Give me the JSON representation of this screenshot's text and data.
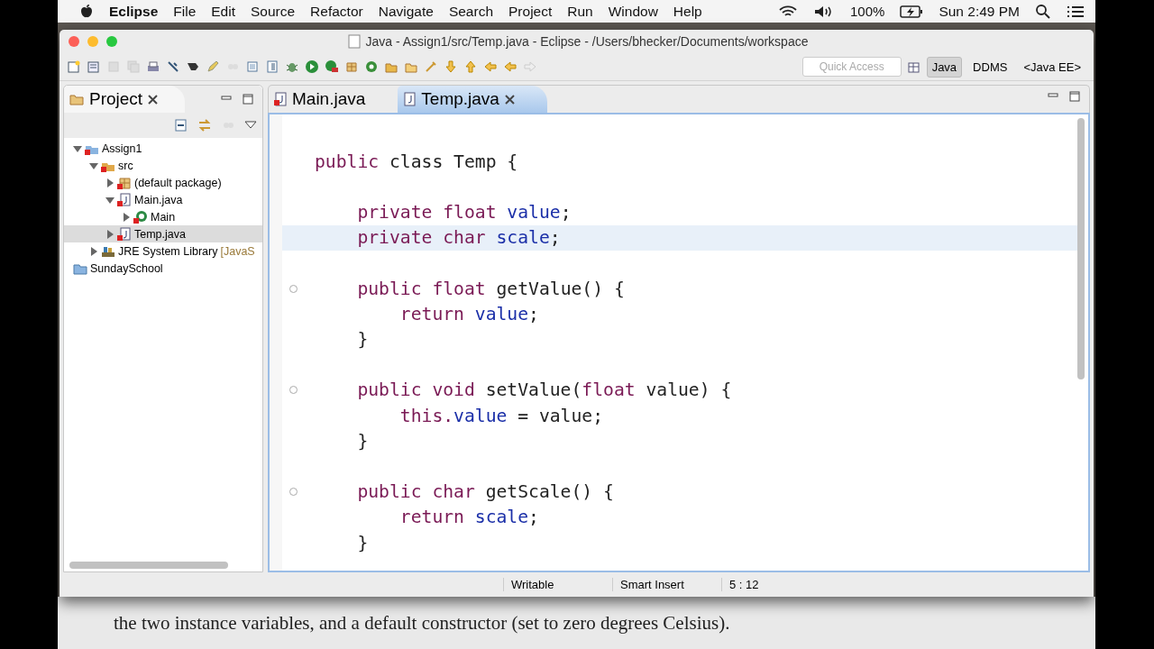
{
  "menubar": {
    "app": "Eclipse",
    "items": [
      "File",
      "Edit",
      "Source",
      "Refactor",
      "Navigate",
      "Search",
      "Project",
      "Run",
      "Window",
      "Help"
    ],
    "battery": "100%",
    "clock": "Sun 2:49 PM"
  },
  "window": {
    "title": "Java - Assign1/src/Temp.java - Eclipse - /Users/bhecker/Documents/workspace"
  },
  "toolbar": {
    "quick_access": {
      "placeholder": "Quick Access"
    },
    "perspectives": [
      {
        "label": "Java",
        "selected": true
      },
      {
        "label": "DDMS",
        "selected": false
      },
      {
        "label": "<Java EE>",
        "selected": false
      }
    ]
  },
  "project_view": {
    "title": "Project",
    "tree": [
      {
        "label": "Assign1",
        "kind": "project",
        "expanded": true,
        "selected": false,
        "children": [
          {
            "label": "src",
            "kind": "folder",
            "expanded": true,
            "selected": false,
            "children": [
              {
                "label": "(default package)",
                "kind": "package",
                "expanded": false,
                "selected": false
              },
              {
                "label": "Main.java",
                "kind": "file",
                "expanded": true,
                "selected": false,
                "children": [
                  {
                    "label": "Main",
                    "kind": "class",
                    "expanded": false,
                    "selected": false
                  }
                ]
              },
              {
                "label": "Temp.java",
                "kind": "file",
                "expanded": false,
                "selected": true
              }
            ]
          },
          {
            "label": "JRE System Library",
            "suffix": "[JavaS",
            "kind": "library",
            "expanded": false,
            "selected": false
          }
        ]
      },
      {
        "label": "SundaySchool",
        "kind": "closed",
        "selected": false
      }
    ]
  },
  "editor": {
    "tabs": [
      {
        "label": "Main.java",
        "selected": false,
        "error": true
      },
      {
        "label": "Temp.java",
        "selected": true,
        "error": false
      }
    ],
    "lines": [
      {
        "fold": false,
        "selected": false
      },
      {
        "fold": false,
        "selected": false,
        "tokens": [
          {
            "text": "public ",
            "kind": "keyword"
          },
          {
            "text": "class Temp {",
            "kind": "plain"
          }
        ]
      },
      {
        "fold": false,
        "selected": false
      },
      {
        "fold": false,
        "selected": false,
        "tokens": [
          {
            "text": "    private float ",
            "kind": "keyword"
          },
          {
            "text": "value",
            "kind": "field"
          },
          {
            "text": ";",
            "kind": "plain"
          }
        ]
      },
      {
        "fold": false,
        "selected": true,
        "tokens": [
          {
            "text": "    private char ",
            "kind": "keyword"
          },
          {
            "text": "scale",
            "kind": "field"
          },
          {
            "text": ";",
            "kind": "plain"
          }
        ]
      },
      {
        "fold": false,
        "selected": false
      },
      {
        "fold": true,
        "selected": false,
        "tokens": [
          {
            "text": "    public float",
            "kind": "keyword"
          },
          {
            "text": " getValue() {",
            "kind": "plain"
          }
        ]
      },
      {
        "fold": false,
        "selected": false,
        "tokens": [
          {
            "text": "        return ",
            "kind": "keyword"
          },
          {
            "text": "value",
            "kind": "field"
          },
          {
            "text": ";",
            "kind": "plain"
          }
        ]
      },
      {
        "fold": false,
        "selected": false,
        "tokens": [
          {
            "text": "    }",
            "kind": "plain"
          }
        ]
      },
      {
        "fold": false,
        "selected": false
      },
      {
        "fold": true,
        "selected": false,
        "tokens": [
          {
            "text": "    public void",
            "kind": "keyword"
          },
          {
            "text": " setValue(",
            "kind": "plain"
          },
          {
            "text": "float",
            "kind": "keyword"
          },
          {
            "text": " value) {",
            "kind": "plain"
          }
        ]
      },
      {
        "fold": false,
        "selected": false,
        "tokens": [
          {
            "text": "        this.",
            "kind": "keyword"
          },
          {
            "text": "value",
            "kind": "field"
          },
          {
            "text": " = value;",
            "kind": "plain"
          }
        ]
      },
      {
        "fold": false,
        "selected": false,
        "tokens": [
          {
            "text": "    }",
            "kind": "plain"
          }
        ]
      },
      {
        "fold": false,
        "selected": false
      },
      {
        "fold": true,
        "selected": false,
        "tokens": [
          {
            "text": "    public char",
            "kind": "keyword"
          },
          {
            "text": " getScale() {",
            "kind": "plain"
          }
        ]
      },
      {
        "fold": false,
        "selected": false,
        "tokens": [
          {
            "text": "        return ",
            "kind": "keyword"
          },
          {
            "text": "scale",
            "kind": "field"
          },
          {
            "text": ";",
            "kind": "plain"
          }
        ]
      },
      {
        "fold": false,
        "selected": false,
        "tokens": [
          {
            "text": "    }",
            "kind": "plain"
          }
        ]
      }
    ]
  },
  "status_bar": [
    "Writable",
    "Smart Insert",
    "5 : 12"
  ],
  "background_document": {
    "text": "the two instance variables, and a default constructor (set to zero degrees Celsius)."
  }
}
